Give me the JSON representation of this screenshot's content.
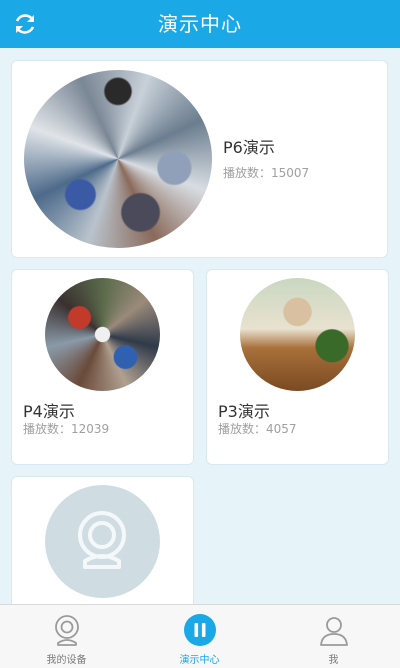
{
  "header": {
    "title": "演示中心"
  },
  "cards": [
    {
      "name": "P6演示",
      "plays": "播放数：15007"
    },
    {
      "name": "P4演示",
      "plays": "播放数：12039"
    },
    {
      "name": "P3演示",
      "plays": "播放数：4057"
    }
  ],
  "placeholder_card": {},
  "tabs": [
    {
      "label": "我的设备",
      "active": false
    },
    {
      "label": "演示中心",
      "active": true
    },
    {
      "label": "我",
      "active": false
    }
  ],
  "colors": {
    "accent": "#1aa9e6",
    "background": "#e6f4fa"
  }
}
